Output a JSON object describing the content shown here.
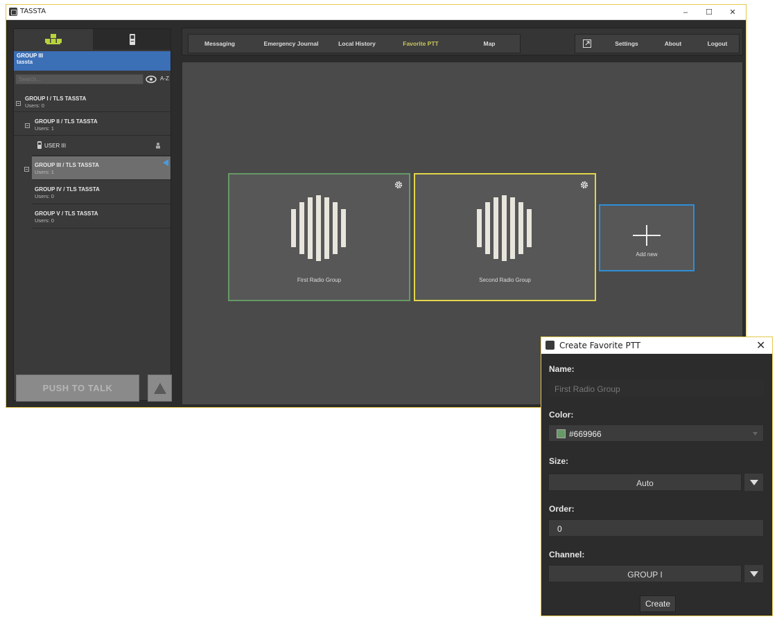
{
  "window": {
    "title": "TASSTA",
    "minimize": "–",
    "maximize": "☐",
    "close": "✕"
  },
  "current_group": {
    "name": "GROUP III",
    "user": "tassta"
  },
  "search": {
    "placeholder": "Search...",
    "sort_label": "A-Z"
  },
  "tree": [
    {
      "name": "GROUP I / TLS TASSTA",
      "users": "Users: 0"
    },
    {
      "name": "GROUP II / TLS TASSTA",
      "users": "Users: 1"
    },
    {
      "name": "USER III"
    },
    {
      "name": "GROUP III / TLS TASSTA",
      "users": "Users: 1"
    },
    {
      "name": "GROUP IV / TLS TASSTA",
      "users": "Users: 0"
    },
    {
      "name": "GROUP V / TLS TASSTA",
      "users": "Users: 0"
    }
  ],
  "ptt": {
    "label": "PUSH TO TALK"
  },
  "nav": {
    "tabs": [
      "Messaging",
      "Emergency Journal",
      "Local History",
      "Favorite PTT",
      "Map"
    ],
    "active": "Favorite PTT",
    "settings": "Settings",
    "about": "About",
    "logout": "Logout"
  },
  "favorites": [
    {
      "label": "First Radio Group",
      "color": "#669966"
    },
    {
      "label": "Second Radio Group",
      "color": "#e3d64a"
    }
  ],
  "add_tile": {
    "label": "Add new",
    "color": "#2f8fd8"
  },
  "dialog": {
    "title": "Create Favorite PTT",
    "close": "✕",
    "name_label": "Name:",
    "name_placeholder": "First Radio Group",
    "color_label": "Color:",
    "color_value": "#669966",
    "size_label": "Size:",
    "size_value": "Auto",
    "order_label": "Order:",
    "order_value": "0",
    "channel_label": "Channel:",
    "channel_value": "GROUP I",
    "create_label": "Create"
  },
  "colors": {
    "accent_blue": "#3b6fb6",
    "active_tab": "#c8c85a",
    "window_border": "#e3c84a"
  }
}
